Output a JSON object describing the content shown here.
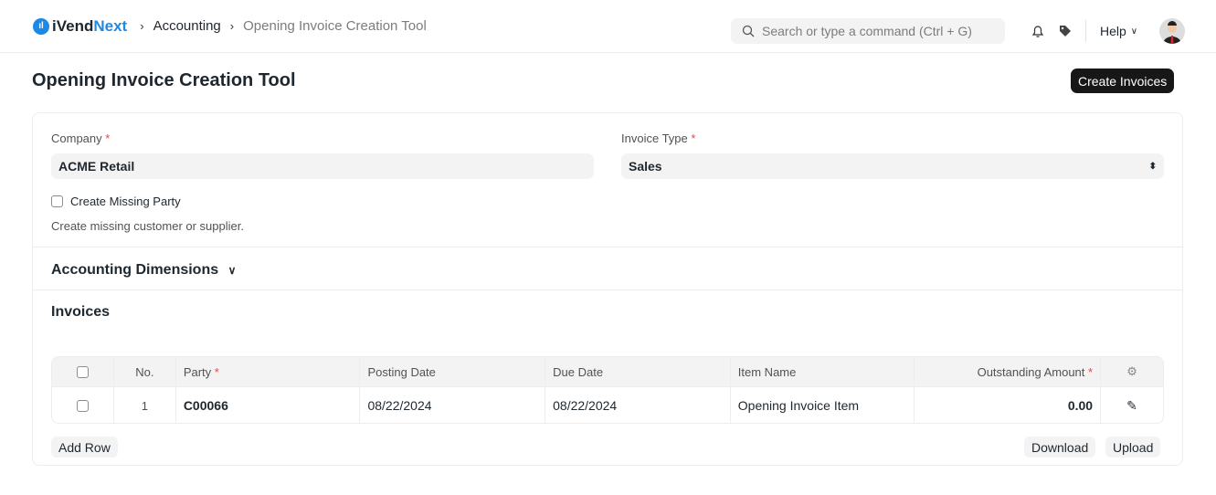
{
  "nav": {
    "logo_prefix": "iVend",
    "logo_suffix": "Next",
    "breadcrumbs": [
      "Accounting",
      "Opening Invoice Creation Tool"
    ],
    "search_placeholder": "Search or type a command (Ctrl + G)",
    "help": "Help"
  },
  "page": {
    "title": "Opening Invoice Creation Tool",
    "primary_action": "Create Invoices"
  },
  "form": {
    "company_label": "Company",
    "company_value": "ACME Retail",
    "invoice_type_label": "Invoice Type",
    "invoice_type_value": "Sales",
    "create_missing_label": "Create Missing Party",
    "create_missing_checked": false,
    "create_missing_help": "Create missing customer or supplier."
  },
  "sections": {
    "dimensions": "Accounting Dimensions",
    "invoices": "Invoices"
  },
  "table": {
    "headers": [
      "No.",
      "Party",
      "Posting Date",
      "Due Date",
      "Item Name",
      "Outstanding Amount"
    ],
    "rows": [
      {
        "no": "1",
        "party": "C00066",
        "posting_date": "08/22/2024",
        "due_date": "08/22/2024",
        "item_name": "Opening Invoice Item",
        "outstanding": "0.00"
      }
    ]
  },
  "buttons": {
    "add_row": "Add Row",
    "download": "Download",
    "upload": "Upload"
  },
  "colors": {
    "accent": "#1e88e5",
    "primary_button": "#171717",
    "required": "#e24c4c"
  }
}
